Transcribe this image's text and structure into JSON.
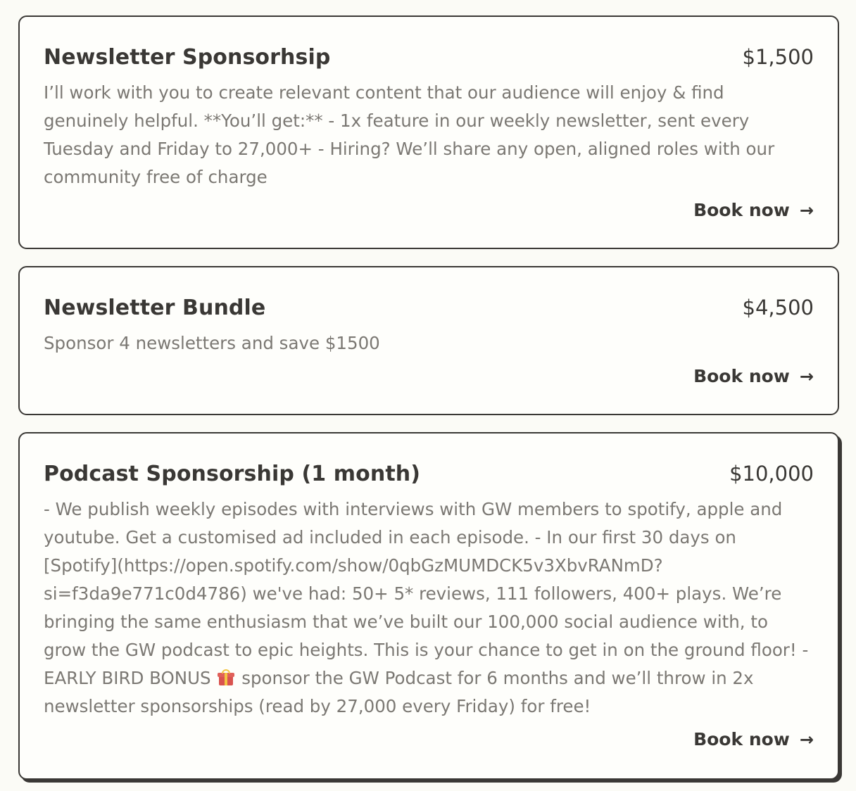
{
  "offers": [
    {
      "title": "Newsletter Sponsorhsip",
      "price": "$1,500",
      "description": "I’ll work with you to create relevant content that our audience will enjoy & find genuinely helpful. **You’ll get:** - 1x feature in our weekly newsletter, sent every Tuesday and Friday to 27,000+ - Hiring? We’ll share any open, aligned roles with our community free of charge",
      "book_label": "Book now",
      "arrow": "→"
    },
    {
      "title": "Newsletter Bundle",
      "price": "$4,500",
      "description": "Sponsor 4 newsletters and save $1500",
      "book_label": "Book now",
      "arrow": "→"
    },
    {
      "title": "Podcast Sponsorship (1 month)",
      "price": "$10,000",
      "description_before_icon": "- We publish weekly episodes with interviews with GW members to spotify, apple and youtube. Get a customised ad included in each episode. - In our first 30 days on [Spotify](https://open.spotify.com/show/0qbGzMUMDCK5v3XbvRANmD?si=f3da9e771c0d4786) we've had: 50+ 5* reviews, 111 followers, 400+ plays. We’re bringing the same enthusiasm that we’ve built our 100,000 social audience with, to grow the GW podcast to epic heights. This is your chance to get in on the ground floor! - EARLY BIRD BONUS",
      "icon": "gift-icon",
      "description_after_icon": "sponsor the GW Podcast for 6 months and we’ll throw in 2x newsletter sponsorships (read by 27,000 every Friday) for free!",
      "book_label": "Book now",
      "arrow": "→"
    }
  ]
}
